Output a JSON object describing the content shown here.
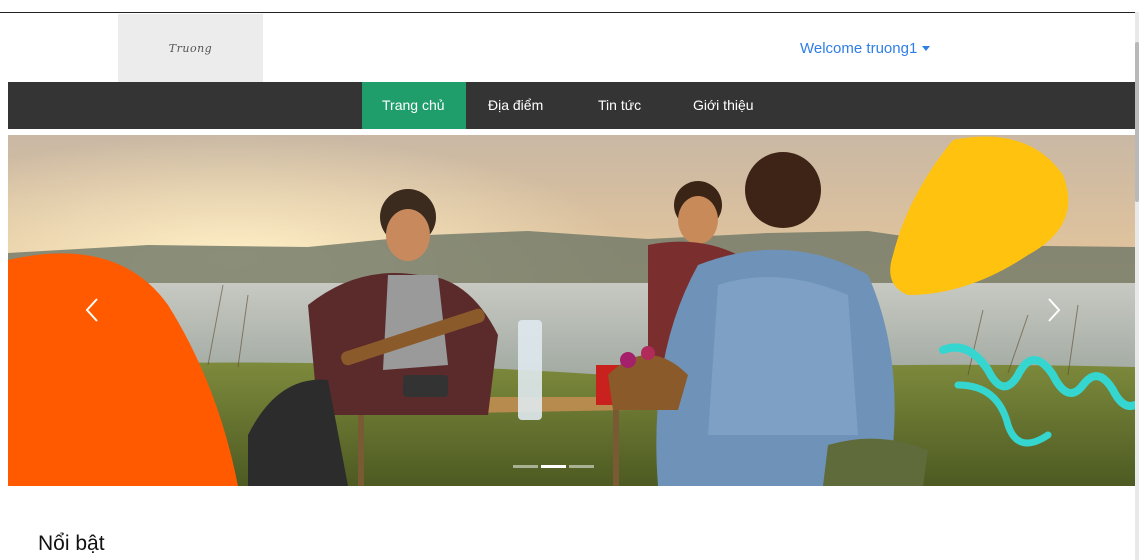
{
  "header": {
    "logo_text": "Truong",
    "welcome_label": "Welcome truong1"
  },
  "nav": {
    "items": [
      {
        "label": "Trang chủ",
        "active": true
      },
      {
        "label": "Địa điểm",
        "active": false
      },
      {
        "label": "Tin tức",
        "active": false
      },
      {
        "label": "Giới thiệu",
        "active": false
      }
    ]
  },
  "carousel": {
    "prev_icon": "chevron-left-icon",
    "next_icon": "chevron-right-icon",
    "slide_count": 3,
    "active_slide": 1
  },
  "section": {
    "title": "Nổi bật"
  },
  "colors": {
    "nav_bg": "#343434",
    "nav_active": "#1f9e6c",
    "link": "#2f7ee6",
    "blob_orange": "#ff5a00",
    "blob_yellow": "#ffc20e",
    "squiggle_teal": "#36d6d0"
  }
}
